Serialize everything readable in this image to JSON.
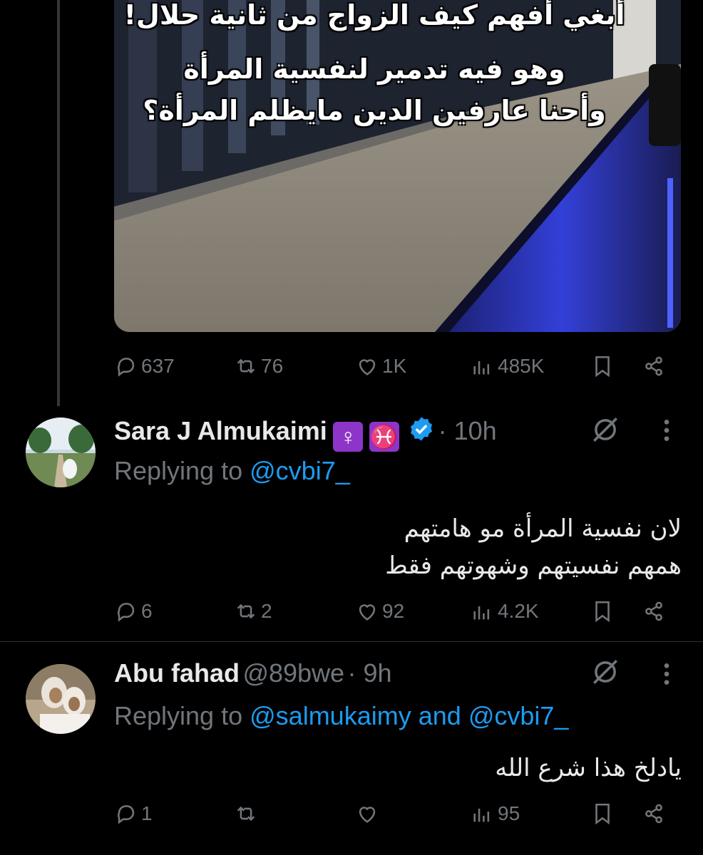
{
  "tweet": {
    "media_caption": [
      "أبغي أفهم كيف الزواج من ثانية حلال!",
      "وهو فيه تدمير لنفسية المرأة",
      "وأحنا عارفين الدين مايظلم المرأة؟"
    ],
    "stats": {
      "replies": "637",
      "reposts": "76",
      "likes": "1K",
      "views": "485K"
    }
  },
  "replies": [
    {
      "name": "Sara J Almukaimi",
      "emoji": [
        "♀",
        "♓"
      ],
      "verified": true,
      "time": "· 10h",
      "replying_label": "Replying to",
      "replying_to": "@cvbi7_",
      "text": [
        "لان نفسية المرأة مو هامتهم",
        "همهم نفسيتهم وشهوتهم فقط"
      ],
      "stats": {
        "replies": "6",
        "reposts": "2",
        "likes": "92",
        "views": "4.2K"
      }
    },
    {
      "name": "Abu fahad",
      "handle": "@89bwe",
      "time": "· 9h",
      "replying_label": "Replying to",
      "replying_to_1": "@salmukaimy",
      "replying_and": "and",
      "replying_to_2": "@cvbi7_",
      "text": [
        "يادلخ هذا شرع الله"
      ],
      "stats": {
        "replies": "1",
        "reposts": "",
        "likes": "",
        "views": "95"
      }
    }
  ],
  "icons": {
    "reply": "reply-icon",
    "repost": "repost-icon",
    "like": "like-icon",
    "views": "views-icon",
    "bookmark": "bookmark-icon",
    "share": "share-icon",
    "grok": "grok-icon",
    "more": "more-icon"
  },
  "colors": {
    "background": "#000000",
    "text": "#e7e9ea",
    "muted": "#71767b",
    "link": "#1d9bf0",
    "verified": "#1d9bf0"
  }
}
